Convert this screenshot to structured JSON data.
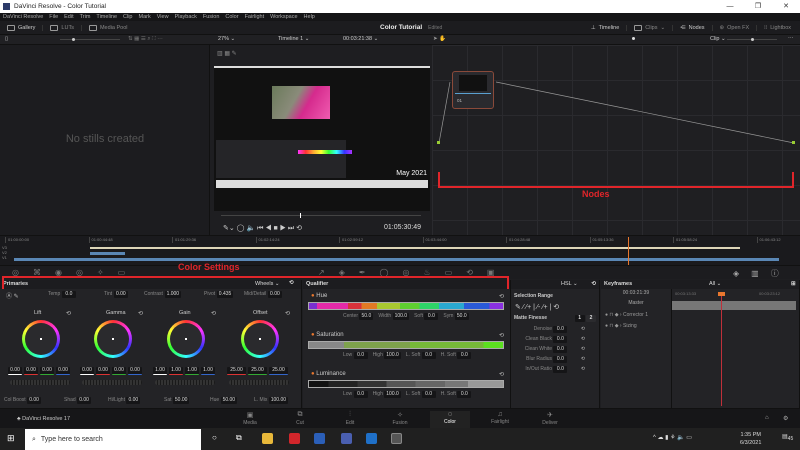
{
  "window": {
    "title": "DaVinci Resolve - Color Tutorial",
    "controls": [
      "—",
      "❐",
      "✕"
    ]
  },
  "menu": [
    "DaVinci Resolve",
    "File",
    "Edit",
    "Trim",
    "Timeline",
    "Clip",
    "Mark",
    "View",
    "Playback",
    "Fusion",
    "Color",
    "Fairlight",
    "Workspace",
    "Help"
  ],
  "toolbar": {
    "gallery": "Gallery",
    "luts": "LUTs",
    "media_pool": "Media Pool",
    "project": "Color Tutorial",
    "status": "Edited",
    "timeline": "Timeline",
    "clips": "Clips",
    "nodes": "Nodes",
    "openfx": "Open FX",
    "lightbox": "Lightbox"
  },
  "viewer": {
    "zoom": "27%",
    "timeline_name": "Timeline 1",
    "timecode": "00:03:21:38",
    "playhead_tc": "01:05:30:49",
    "overlay_date": "May 2021",
    "clip_mode": "Clip"
  },
  "gallery": {
    "empty": "No stills created"
  },
  "nodes": {
    "node_label": "01",
    "annotation": "Nodes"
  },
  "timeline": {
    "ticks": [
      "01:00:00:00",
      "01:00:44:48",
      "01:01:29:36",
      "01:02:14:24",
      "01:02:59:12",
      "01:03:44:00",
      "01:04:28:48",
      "01:05:13:36",
      "01:05:58:24",
      "01:06:43:12"
    ],
    "tracks": [
      "V3",
      "V2",
      "V1"
    ],
    "annotation": "Color Settings"
  },
  "primaries": {
    "title": "Primaries",
    "mode": "Wheels",
    "temp_label": "Temp",
    "temp": "0.0",
    "tint_label": "Tint",
    "tint": "0.00",
    "contrast_label": "Contrast",
    "contrast": "1.000",
    "pivot_label": "Pivot",
    "pivot": "0.435",
    "middetail_label": "Mid/Detail",
    "middetail": "0.00",
    "wheels": [
      {
        "name": "Lift",
        "values": [
          "0.00",
          "0.00",
          "0.00",
          "0.00"
        ]
      },
      {
        "name": "Gamma",
        "values": [
          "0.00",
          "0.00",
          "0.00",
          "0.00"
        ]
      },
      {
        "name": "Gain",
        "values": [
          "1.00",
          "1.00",
          "1.00",
          "1.00"
        ]
      },
      {
        "name": "Offset",
        "values": [
          "25.00",
          "25.00",
          "25.00"
        ]
      }
    ],
    "colboost_label": "Col Boost",
    "colboost": "0.00",
    "shad_label": "Shad",
    "shad": "0.00",
    "hilight_label": "Hi/Light",
    "hilight": "0.00",
    "sat_label": "Sat",
    "sat": "50.00",
    "hue_label": "Hue",
    "hue": "50.00",
    "lmix_label": "L. Mix",
    "lmix": "100.00"
  },
  "qualifier": {
    "title": "Qualifier",
    "mode": "HSL",
    "hue": {
      "label": "Hue",
      "center_label": "Center",
      "center": "50.0",
      "width_label": "Width",
      "width": "100.0",
      "soft_label": "Soft",
      "soft": "0.0",
      "sym_label": "Sym",
      "sym": "50.0"
    },
    "saturation": {
      "label": "Saturation",
      "low_label": "Low",
      "low": "0.0",
      "high_label": "High",
      "high": "100.0",
      "lsoft_label": "L. Soft",
      "lsoft": "0.0",
      "hsoft_label": "H. Soft",
      "hsoft": "0.0"
    },
    "luminance": {
      "label": "Luminance",
      "low_label": "Low",
      "low": "0.0",
      "high_label": "High",
      "high": "100.0",
      "lsoft_label": "L. Soft",
      "lsoft": "0.0",
      "hsoft_label": "H. Soft",
      "hsoft": "0.0"
    }
  },
  "selection": {
    "title": "Selection Range",
    "matte_label": "Matte Finesse",
    "tab1": "1",
    "tab2": "2",
    "rows": [
      {
        "label": "Denoise",
        "value": "0.0"
      },
      {
        "label": "Clean Black",
        "value": "0.0"
      },
      {
        "label": "Clean White",
        "value": "0.0"
      },
      {
        "label": "Blur Radius",
        "value": "0.0"
      },
      {
        "label": "In/Out Ratio",
        "value": "0.0"
      }
    ]
  },
  "keyframes": {
    "title": "Keyframes",
    "filter": "All",
    "timecode": "00:03:21:39",
    "tick1": "00:03:13:33",
    "tick2": "00:03:23:12",
    "rows": [
      "Master",
      "Corrector 1",
      "Sizing"
    ]
  },
  "pages": {
    "app": "DaVinci Resolve 17",
    "items": [
      "Media",
      "Cut",
      "Edit",
      "Fusion",
      "Color",
      "Fairlight",
      "Deliver"
    ],
    "active": "Color"
  },
  "taskbar": {
    "search_placeholder": "Type here to search",
    "time": "1:35 PM",
    "date": "6/3/2021",
    "notif": "45"
  },
  "colors": {
    "accent": "#e0252a",
    "playhead": "#e8772e",
    "clip": "#5a87b5"
  }
}
